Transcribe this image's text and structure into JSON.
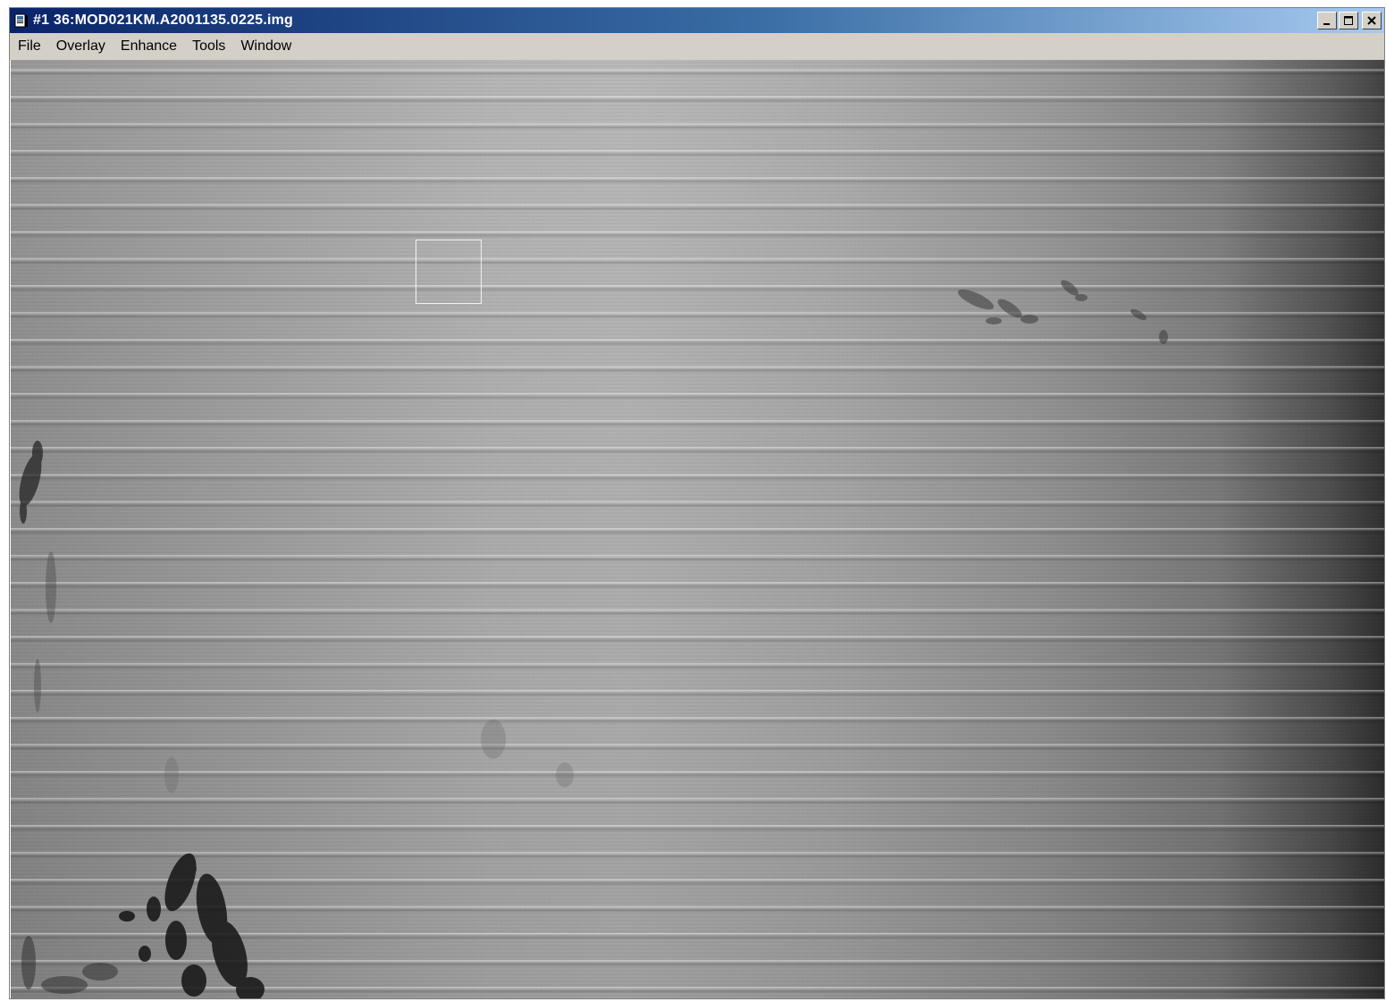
{
  "window": {
    "title": "#1 36:MOD021KM.A2001135.0225.img",
    "app_icon": "image-window-icon",
    "controls": {
      "minimize_icon": "minimize-icon",
      "maximize_icon": "maximize-icon",
      "close_icon": "close-icon"
    }
  },
  "menu": {
    "items": [
      {
        "label": "File"
      },
      {
        "label": "Overlay"
      },
      {
        "label": "Enhance"
      },
      {
        "label": "Tools"
      },
      {
        "label": "Window"
      }
    ]
  },
  "image": {
    "description_colors": {
      "bright": "#b3b3b3",
      "dark_edge": "#2f2f2f",
      "roi_box": "#f2f2f2"
    }
  }
}
